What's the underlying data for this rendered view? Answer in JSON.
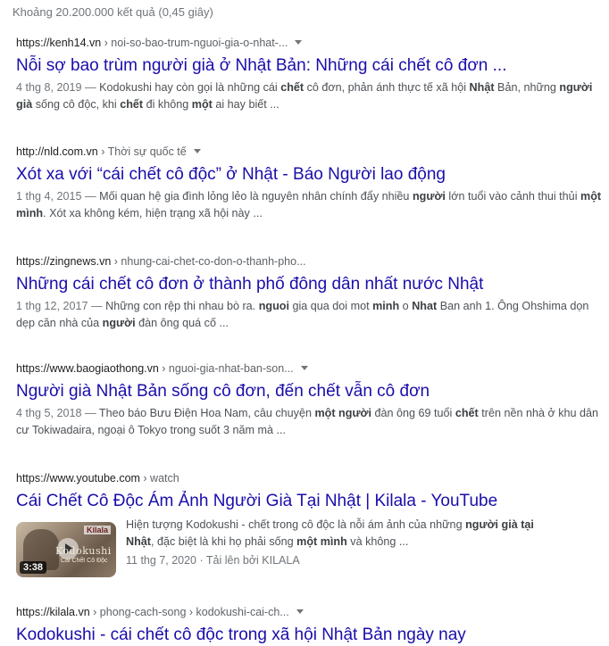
{
  "search": {
    "stats": "Khoảng 20.200.000 kết quả (0,45 giây)"
  },
  "results": [
    {
      "domain": "https://kenh14.vn",
      "path": " › noi-so-bao-trum-nguoi-gia-o-nhat-...",
      "title": "Nỗi sợ bao trùm người già ở Nhật Bản: Những cái chết cô đơn ...",
      "snippet": [
        {
          "t": "4 thg 8, 2019 — ",
          "date": true
        },
        {
          "t": "Kodokushi hay còn gọi là những cái "
        },
        {
          "t": "chết",
          "b": true
        },
        {
          "t": " cô đơn, phản ánh thực tế xã hội "
        },
        {
          "t": "Nhật",
          "b": true
        },
        {
          "t": " Bản, những "
        },
        {
          "t": "người già",
          "b": true
        },
        {
          "t": " sống cô độc, khi "
        },
        {
          "t": "chết",
          "b": true
        },
        {
          "t": " đi không "
        },
        {
          "t": "một",
          "b": true
        },
        {
          "t": " ai hay biết ..."
        }
      ]
    },
    {
      "domain": "http://nld.com.vn",
      "path": " › Thời sự quốc tế",
      "title": "Xót xa với “cái chết cô độc” ở Nhật - Báo Người lao động",
      "snippet": [
        {
          "t": "1 thg 4, 2015 — ",
          "date": true
        },
        {
          "t": "Mối quan hệ gia đình lỏng lẻo là nguyên nhân chính đẩy nhiều "
        },
        {
          "t": "người",
          "b": true
        },
        {
          "t": " lớn tuổi vào cảnh thui thủi "
        },
        {
          "t": "một mình",
          "b": true
        },
        {
          "t": ". Xót xa không kém, hiện trạng xã hội này ..."
        }
      ]
    },
    {
      "domain": "https://zingnews.vn",
      "path": " › nhung-cai-chet-co-don-o-thanh-pho...",
      "title": "Những cái chết cô đơn ở thành phố đông dân nhất nước Nhật",
      "snippet": [
        {
          "t": "1 thg 12, 2017 — ",
          "date": true
        },
        {
          "t": "Những con rệp thi nhau bò ra. "
        },
        {
          "t": "nguoi",
          "b": true
        },
        {
          "t": " gia qua doi mot "
        },
        {
          "t": "minh",
          "b": true
        },
        {
          "t": " o "
        },
        {
          "t": "Nhat",
          "b": true
        },
        {
          "t": " Ban anh 1. Ông Ohshima dọn dẹp căn nhà của "
        },
        {
          "t": "người",
          "b": true
        },
        {
          "t": " đàn ông quá cố ..."
        }
      ]
    },
    {
      "domain": "https://www.baogiaothong.vn",
      "path": " › nguoi-gia-nhat-ban-son...",
      "title": "Người già Nhật Bản sống cô đơn, đến chết vẫn cô đơn",
      "snippet": [
        {
          "t": "4 thg 5, 2018 — ",
          "date": true
        },
        {
          "t": "Theo báo Bưu Điện Hoa Nam, câu chuyện "
        },
        {
          "t": "một người",
          "b": true
        },
        {
          "t": " đàn ông 69 tuổi "
        },
        {
          "t": "chết",
          "b": true
        },
        {
          "t": " trên nền nhà ở khu dân cư Tokiwadaira, ngoại ô Tokyo trong suốt 3 năm mà ..."
        }
      ]
    },
    {
      "domain": "https://www.youtube.com",
      "path": " › watch",
      "title": "Cái Chết Cô Độc Ám Ảnh Người Già Tại Nhật | Kilala - YouTube",
      "video": {
        "duration": "3:38",
        "thumb_logo": "Kilala",
        "thumb_caption": "Kodokushi",
        "thumb_sub": "Cái Chết Cô Độc",
        "snippet": [
          {
            "t": "Hiện tượng Kodokushi - chết trong cô độc là nỗi ám ảnh của những "
          },
          {
            "t": "người già tại Nhật",
            "b": true
          },
          {
            "t": ", đặc biệt là khi họ phải sống "
          },
          {
            "t": "một mình",
            "b": true
          },
          {
            "t": " và không ..."
          }
        ],
        "meta": "11 thg 7, 2020 · Tải lên bởi KILALA"
      }
    },
    {
      "domain": "https://kilala.vn",
      "path": " › phong-cach-song › kodokushi-cai-ch...",
      "title": "Kodokushi - cái chết cô độc trong xã hội Nhật Bản ngày nay"
    }
  ]
}
